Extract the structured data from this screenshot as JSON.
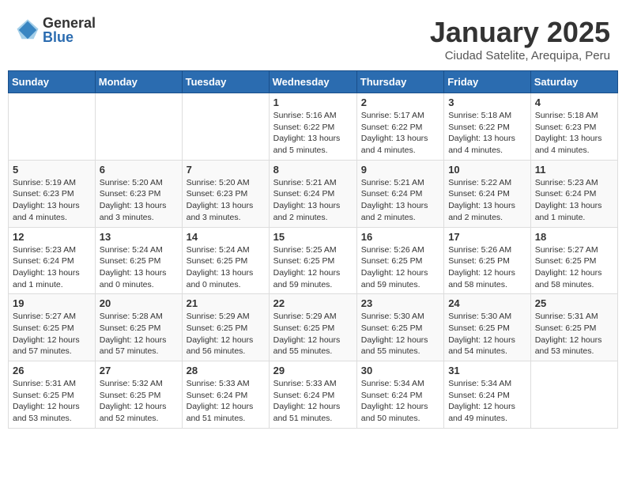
{
  "header": {
    "logo_general": "General",
    "logo_blue": "Blue",
    "month_title": "January 2025",
    "location": "Ciudad Satelite, Arequipa, Peru"
  },
  "weekdays": [
    "Sunday",
    "Monday",
    "Tuesday",
    "Wednesday",
    "Thursday",
    "Friday",
    "Saturday"
  ],
  "weeks": [
    [
      {
        "day": "",
        "info": ""
      },
      {
        "day": "",
        "info": ""
      },
      {
        "day": "",
        "info": ""
      },
      {
        "day": "1",
        "info": "Sunrise: 5:16 AM\nSunset: 6:22 PM\nDaylight: 13 hours and 5 minutes."
      },
      {
        "day": "2",
        "info": "Sunrise: 5:17 AM\nSunset: 6:22 PM\nDaylight: 13 hours and 4 minutes."
      },
      {
        "day": "3",
        "info": "Sunrise: 5:18 AM\nSunset: 6:22 PM\nDaylight: 13 hours and 4 minutes."
      },
      {
        "day": "4",
        "info": "Sunrise: 5:18 AM\nSunset: 6:23 PM\nDaylight: 13 hours and 4 minutes."
      }
    ],
    [
      {
        "day": "5",
        "info": "Sunrise: 5:19 AM\nSunset: 6:23 PM\nDaylight: 13 hours and 4 minutes."
      },
      {
        "day": "6",
        "info": "Sunrise: 5:20 AM\nSunset: 6:23 PM\nDaylight: 13 hours and 3 minutes."
      },
      {
        "day": "7",
        "info": "Sunrise: 5:20 AM\nSunset: 6:23 PM\nDaylight: 13 hours and 3 minutes."
      },
      {
        "day": "8",
        "info": "Sunrise: 5:21 AM\nSunset: 6:24 PM\nDaylight: 13 hours and 2 minutes."
      },
      {
        "day": "9",
        "info": "Sunrise: 5:21 AM\nSunset: 6:24 PM\nDaylight: 13 hours and 2 minutes."
      },
      {
        "day": "10",
        "info": "Sunrise: 5:22 AM\nSunset: 6:24 PM\nDaylight: 13 hours and 2 minutes."
      },
      {
        "day": "11",
        "info": "Sunrise: 5:23 AM\nSunset: 6:24 PM\nDaylight: 13 hours and 1 minute."
      }
    ],
    [
      {
        "day": "12",
        "info": "Sunrise: 5:23 AM\nSunset: 6:24 PM\nDaylight: 13 hours and 1 minute."
      },
      {
        "day": "13",
        "info": "Sunrise: 5:24 AM\nSunset: 6:25 PM\nDaylight: 13 hours and 0 minutes."
      },
      {
        "day": "14",
        "info": "Sunrise: 5:24 AM\nSunset: 6:25 PM\nDaylight: 13 hours and 0 minutes."
      },
      {
        "day": "15",
        "info": "Sunrise: 5:25 AM\nSunset: 6:25 PM\nDaylight: 12 hours and 59 minutes."
      },
      {
        "day": "16",
        "info": "Sunrise: 5:26 AM\nSunset: 6:25 PM\nDaylight: 12 hours and 59 minutes."
      },
      {
        "day": "17",
        "info": "Sunrise: 5:26 AM\nSunset: 6:25 PM\nDaylight: 12 hours and 58 minutes."
      },
      {
        "day": "18",
        "info": "Sunrise: 5:27 AM\nSunset: 6:25 PM\nDaylight: 12 hours and 58 minutes."
      }
    ],
    [
      {
        "day": "19",
        "info": "Sunrise: 5:27 AM\nSunset: 6:25 PM\nDaylight: 12 hours and 57 minutes."
      },
      {
        "day": "20",
        "info": "Sunrise: 5:28 AM\nSunset: 6:25 PM\nDaylight: 12 hours and 57 minutes."
      },
      {
        "day": "21",
        "info": "Sunrise: 5:29 AM\nSunset: 6:25 PM\nDaylight: 12 hours and 56 minutes."
      },
      {
        "day": "22",
        "info": "Sunrise: 5:29 AM\nSunset: 6:25 PM\nDaylight: 12 hours and 55 minutes."
      },
      {
        "day": "23",
        "info": "Sunrise: 5:30 AM\nSunset: 6:25 PM\nDaylight: 12 hours and 55 minutes."
      },
      {
        "day": "24",
        "info": "Sunrise: 5:30 AM\nSunset: 6:25 PM\nDaylight: 12 hours and 54 minutes."
      },
      {
        "day": "25",
        "info": "Sunrise: 5:31 AM\nSunset: 6:25 PM\nDaylight: 12 hours and 53 minutes."
      }
    ],
    [
      {
        "day": "26",
        "info": "Sunrise: 5:31 AM\nSunset: 6:25 PM\nDaylight: 12 hours and 53 minutes."
      },
      {
        "day": "27",
        "info": "Sunrise: 5:32 AM\nSunset: 6:25 PM\nDaylight: 12 hours and 52 minutes."
      },
      {
        "day": "28",
        "info": "Sunrise: 5:33 AM\nSunset: 6:24 PM\nDaylight: 12 hours and 51 minutes."
      },
      {
        "day": "29",
        "info": "Sunrise: 5:33 AM\nSunset: 6:24 PM\nDaylight: 12 hours and 51 minutes."
      },
      {
        "day": "30",
        "info": "Sunrise: 5:34 AM\nSunset: 6:24 PM\nDaylight: 12 hours and 50 minutes."
      },
      {
        "day": "31",
        "info": "Sunrise: 5:34 AM\nSunset: 6:24 PM\nDaylight: 12 hours and 49 minutes."
      },
      {
        "day": "",
        "info": ""
      }
    ]
  ]
}
